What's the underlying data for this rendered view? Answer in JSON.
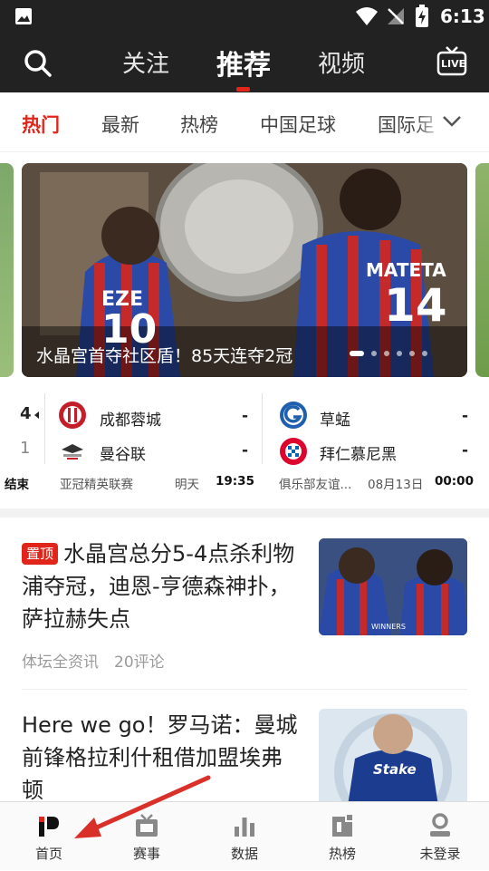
{
  "status_bar": {
    "time": "6:13"
  },
  "top_nav": {
    "tabs": [
      {
        "label": "关注",
        "active": false
      },
      {
        "label": "推荐",
        "active": true
      },
      {
        "label": "视频",
        "active": false
      }
    ],
    "live_label": "LIVE"
  },
  "categories": {
    "items": [
      "热门",
      "最新",
      "热榜",
      "中国足球",
      "国际足"
    ],
    "active": "热门"
  },
  "carousel": {
    "caption": "水晶宫首夺社区盾！85天连夺2冠",
    "jersey_left_name": "EZE",
    "jersey_left_number": "10",
    "jersey_right_name": "MATETA",
    "jersey_right_number": "14"
  },
  "scores": {
    "partial_left": {
      "top": "4",
      "bottom": "1",
      "status": "结束"
    },
    "matches": [
      {
        "home": "成都蓉城",
        "home_score": "-",
        "away": "曼谷联",
        "away_score": "-",
        "competition": "亚冠精英联赛",
        "date": "明天",
        "time": "19:35"
      },
      {
        "home": "草蜢",
        "home_score": "-",
        "away": "拜仁慕尼黑",
        "away_score": "-",
        "competition": "俱乐部友谊...",
        "date": "08月13日",
        "time": "00:00"
      }
    ]
  },
  "news": [
    {
      "badge": "置顶",
      "title": "水晶宫总分5-4点杀利物浦夺冠，迪恩-亨德森神扑，萨拉赫失点",
      "source": "体坛全资讯",
      "comments": "20评论",
      "thumb_text": "WINNERS"
    },
    {
      "badge": "",
      "title": "Here we go！罗马诺：曼城前锋格拉利什租借加盟埃弗顿",
      "source": "",
      "comments": "",
      "thumb_text": "Stake"
    }
  ],
  "bottom_nav": {
    "items": [
      {
        "label": "首页",
        "icon": "home-icon"
      },
      {
        "label": "赛事",
        "icon": "tv-icon"
      },
      {
        "label": "数据",
        "icon": "bar-chart-icon"
      },
      {
        "label": "热榜",
        "icon": "hot-list-icon"
      },
      {
        "label": "未登录",
        "icon": "user-icon"
      }
    ]
  },
  "colors": {
    "accent": "#e1251b",
    "topbar": "#222222"
  }
}
